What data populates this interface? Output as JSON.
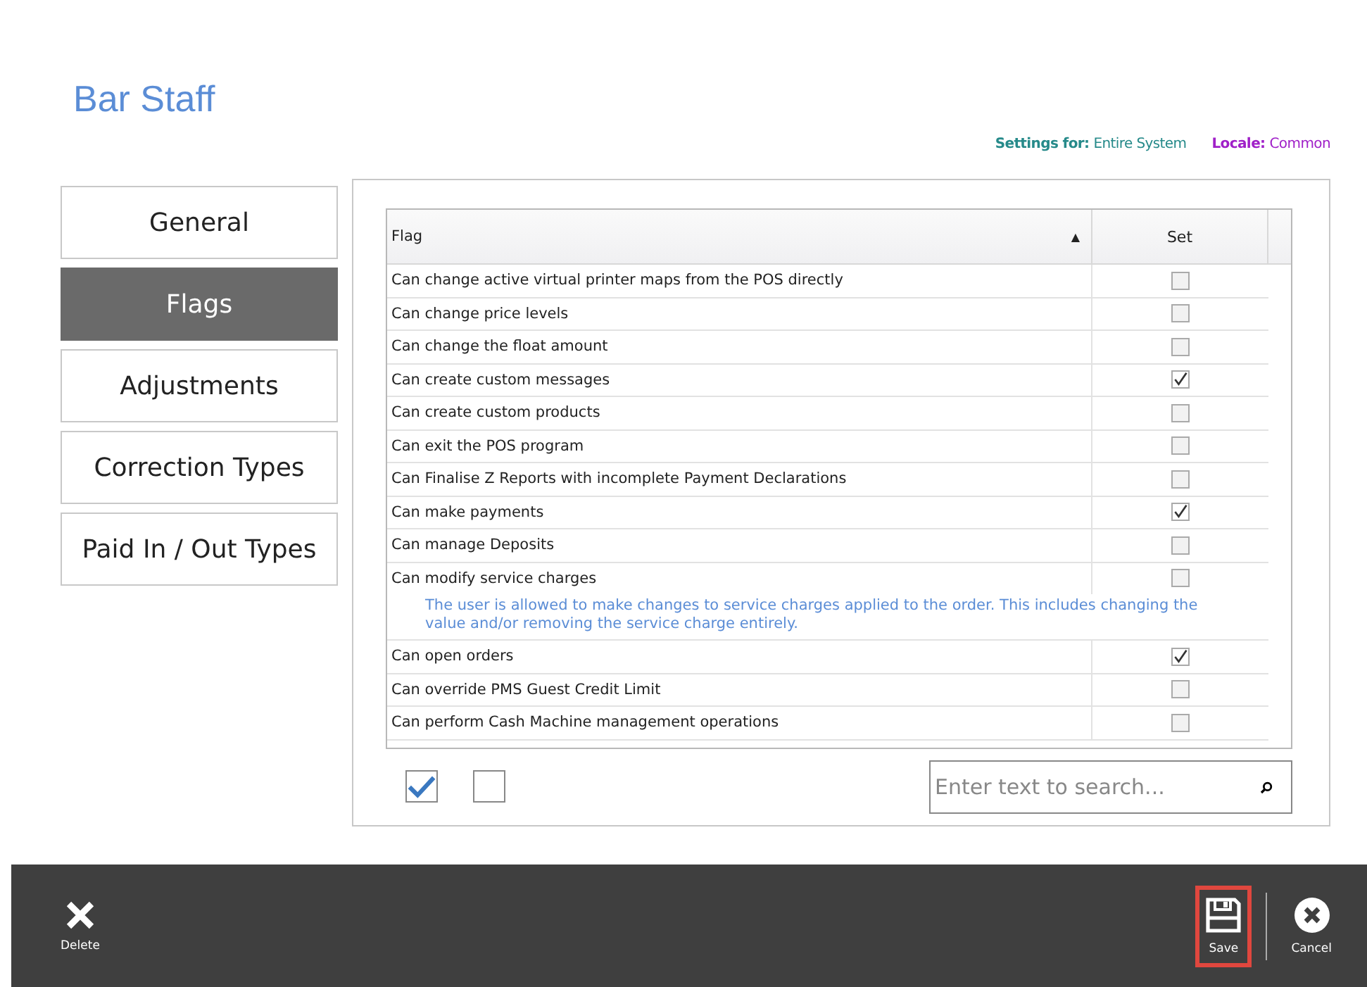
{
  "title": "Bar Staff",
  "settings": {
    "settings_for_label": "Settings for:",
    "settings_for_value": "Entire System",
    "locale_label": "Locale:",
    "locale_value": "Common"
  },
  "sidebar": {
    "items": [
      {
        "label": "General",
        "selected": false
      },
      {
        "label": "Flags",
        "selected": true
      },
      {
        "label": "Adjustments",
        "selected": false
      },
      {
        "label": "Correction Types",
        "selected": false
      },
      {
        "label": "Paid In / Out Types",
        "selected": false
      }
    ]
  },
  "table": {
    "columns": [
      {
        "label": "Flag",
        "sort": "▲"
      },
      {
        "label": "Set"
      }
    ],
    "rows": [
      {
        "flag": "Can change active virtual printer maps from the POS directly",
        "checked": false
      },
      {
        "flag": "Can change price levels",
        "checked": false
      },
      {
        "flag": "Can change the float amount",
        "checked": false
      },
      {
        "flag": "Can create custom messages",
        "checked": true
      },
      {
        "flag": "Can create custom products",
        "checked": false
      },
      {
        "flag": "Can exit the POS program",
        "checked": false
      },
      {
        "flag": "Can Finalise Z Reports with incomplete Payment Declarations",
        "checked": false
      },
      {
        "flag": "Can make payments",
        "checked": true
      },
      {
        "flag": "Can manage Deposits",
        "checked": false
      },
      {
        "flag": "Can modify service charges",
        "checked": false,
        "description": "The user is allowed to make changes to service charges applied to the order. This includes changing the value and/or removing the service charge entirely."
      },
      {
        "flag": "Can open orders",
        "checked": true
      },
      {
        "flag": "Can override PMS Guest Credit Limit",
        "checked": false
      },
      {
        "flag": "Can perform Cash Machine management operations",
        "checked": false
      }
    ]
  },
  "bulk_buttons": [
    {
      "kind": "check-all"
    },
    {
      "kind": "uncheck-all"
    }
  ],
  "search": {
    "placeholder": "Enter text to search..."
  },
  "toolbar": {
    "left": [
      {
        "kind": "delete",
        "label": "Delete",
        "highlighted": false
      }
    ],
    "right": [
      {
        "kind": "save",
        "label": "Save",
        "highlighted": true
      },
      {
        "kind": "cancel",
        "label": "Cancel",
        "highlighted": false
      }
    ]
  }
}
